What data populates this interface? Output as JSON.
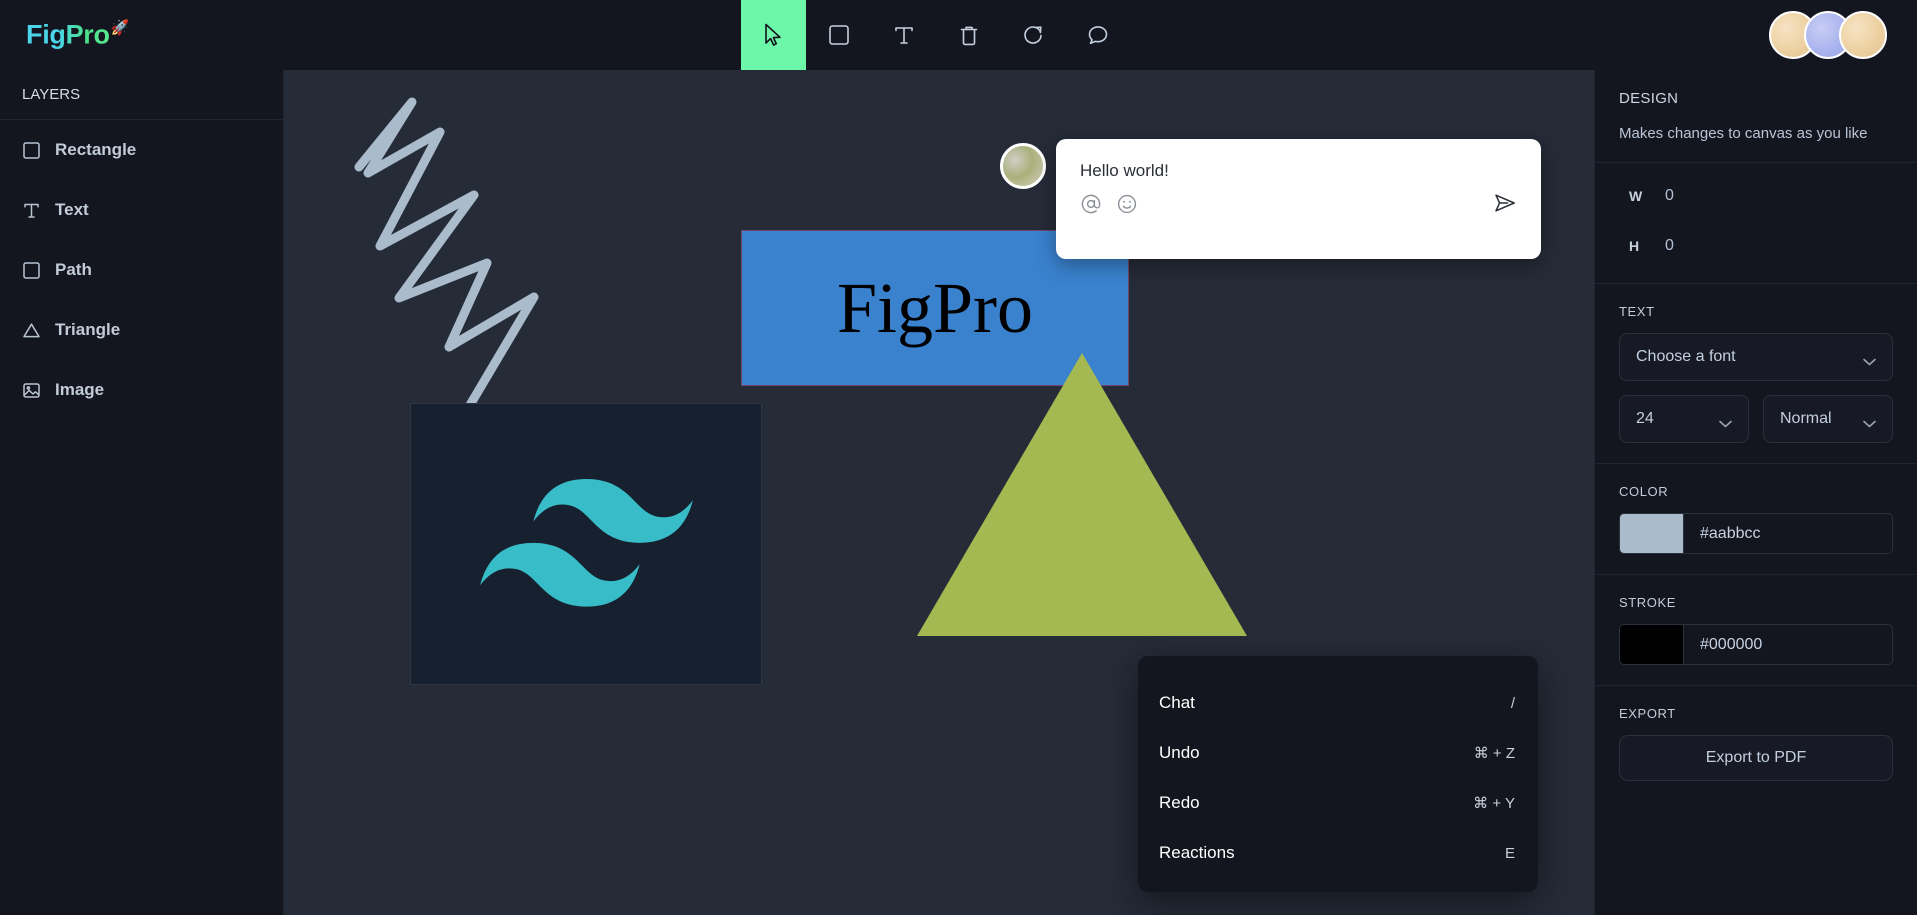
{
  "app": {
    "logo_text": "FigPro",
    "logo_icon": "rocket-icon",
    "logo_emoji": "🚀"
  },
  "toolbar": {
    "tools": [
      {
        "name": "select-cursor-tool",
        "icon": "cursor-icon",
        "active": true
      },
      {
        "name": "rectangle-tool",
        "icon": "square-icon",
        "active": false
      },
      {
        "name": "text-tool",
        "icon": "text-t-icon",
        "active": false
      },
      {
        "name": "delete-tool",
        "icon": "trash-icon",
        "active": false
      },
      {
        "name": "reset-tool",
        "icon": "refresh-circular-arrow-icon",
        "active": false
      },
      {
        "name": "comment-tool",
        "icon": "speech-bubble-icon",
        "active": false
      }
    ]
  },
  "active_users": {
    "count": 3,
    "avatars": [
      "avatar-cream",
      "avatar-periwinkle",
      "avatar-tan"
    ]
  },
  "sidebar": {
    "header": "LAYERS",
    "items": [
      {
        "label": "Rectangle",
        "icon": "square-icon"
      },
      {
        "label": "Text",
        "icon": "text-t-icon"
      },
      {
        "label": "Path",
        "icon": "square-icon"
      },
      {
        "label": "Triangle",
        "icon": "triangle-icon"
      },
      {
        "label": "Image",
        "icon": "image-icon"
      }
    ]
  },
  "canvas": {
    "background_color": "#252b37",
    "objects": {
      "path": {
        "name": "freehand-zigzag-path",
        "stroke_color": "#aabbcc"
      },
      "rectangle": {
        "name": "blue-rectangle",
        "fill_color": "#3a82ce",
        "text": "FigPro",
        "text_color": "#000000"
      },
      "triangle": {
        "name": "olive-triangle",
        "fill_color": "#a5b952"
      },
      "image": {
        "name": "tailwind-logo-image",
        "background_color": "#16202f",
        "logo_color": "#38bdc8"
      }
    }
  },
  "chat": {
    "message": "Hello world!",
    "mention_icon": "at-sign-icon",
    "emoji_icon": "smiley-face-icon",
    "send_icon": "paper-plane-send-icon"
  },
  "context_menu": {
    "items": [
      {
        "label": "Chat",
        "shortcut": "/"
      },
      {
        "label": "Undo",
        "shortcut": "⌘ + Z"
      },
      {
        "label": "Redo",
        "shortcut": "⌘ + Y"
      },
      {
        "label": "Reactions",
        "shortcut": "E"
      }
    ]
  },
  "design_panel": {
    "title": "DESIGN",
    "subtitle": "Makes changes to canvas as you like",
    "dimensions": {
      "width_label": "W",
      "width_value": "0",
      "height_label": "H",
      "height_value": "0"
    },
    "text_section": {
      "label": "TEXT",
      "font_family": "Choose a font",
      "font_size": "24",
      "font_weight": "Normal"
    },
    "color_section": {
      "label": "COLOR",
      "value": "#aabbcc"
    },
    "stroke_section": {
      "label": "STROKE",
      "value": "#000000"
    },
    "export_section": {
      "label": "EXPORT",
      "button_label": "Export to PDF"
    }
  }
}
